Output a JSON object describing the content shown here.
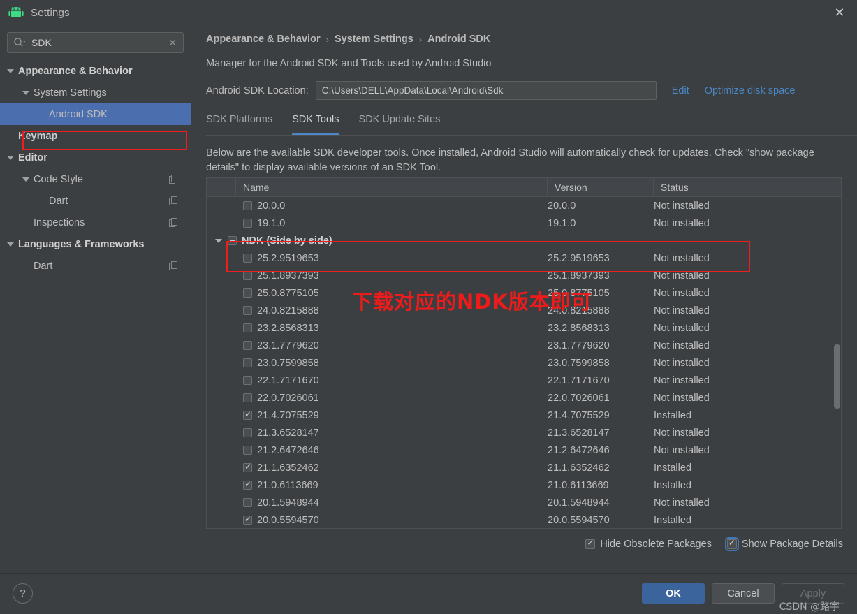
{
  "window": {
    "title": "Settings",
    "logo_icon": "android-logo-icon",
    "close_icon": "close-icon"
  },
  "search": {
    "value": "SDK",
    "placeholder": "Search settings",
    "icon": "search-icon",
    "clear_icon": "clear-icon"
  },
  "sidebar": {
    "items": [
      {
        "label": "Appearance & Behavior",
        "level": 0,
        "bold": true,
        "expandable": true,
        "selected": false,
        "copy": false
      },
      {
        "label": "System Settings",
        "level": 1,
        "bold": false,
        "expandable": true,
        "selected": false,
        "copy": false
      },
      {
        "label": "Android SDK",
        "level": 2,
        "bold": false,
        "expandable": false,
        "selected": true,
        "copy": false
      },
      {
        "label": "Keymap",
        "level": 0,
        "bold": true,
        "expandable": false,
        "selected": false,
        "copy": false
      },
      {
        "label": "Editor",
        "level": 0,
        "bold": true,
        "expandable": true,
        "selected": false,
        "copy": false
      },
      {
        "label": "Code Style",
        "level": 1,
        "bold": false,
        "expandable": true,
        "selected": false,
        "copy": true
      },
      {
        "label": "Dart",
        "level": 2,
        "bold": false,
        "expandable": false,
        "selected": false,
        "copy": true
      },
      {
        "label": "Inspections",
        "level": 1,
        "bold": false,
        "expandable": false,
        "selected": false,
        "copy": true
      },
      {
        "label": "Languages & Frameworks",
        "level": 0,
        "bold": true,
        "expandable": true,
        "selected": false,
        "copy": false
      },
      {
        "label": "Dart",
        "level": 1,
        "bold": false,
        "expandable": false,
        "selected": false,
        "copy": true
      }
    ]
  },
  "main": {
    "breadcrumb": [
      "Appearance & Behavior",
      "System Settings",
      "Android SDK"
    ],
    "breadcrumb_separator": "›",
    "subtitle": "Manager for the Android SDK and Tools used by Android Studio",
    "location_label": "Android SDK Location:",
    "location_value": "C:\\Users\\DELL\\AppData\\Local\\Android\\Sdk",
    "edit_link": "Edit",
    "optimize_link": "Optimize disk space",
    "tabs": [
      {
        "label": "SDK Platforms",
        "active": false
      },
      {
        "label": "SDK Tools",
        "active": true
      },
      {
        "label": "SDK Update Sites",
        "active": false
      }
    ],
    "description": "Below are the available SDK developer tools. Once installed, Android Studio will automatically check for updates. Check \"show package details\" to display available versions of an SDK Tool."
  },
  "table": {
    "columns": [
      "",
      "Name",
      "Version",
      "Status"
    ],
    "rows": [
      {
        "name": "20.0.0",
        "version": "20.0.0",
        "status": "Not installed",
        "state": "unchecked",
        "group": false
      },
      {
        "name": "19.1.0",
        "version": "19.1.0",
        "status": "Not installed",
        "state": "unchecked",
        "group": false
      },
      {
        "name": "NDK (Side by side)",
        "version": "",
        "status": "",
        "state": "partial",
        "group": true
      },
      {
        "name": "25.2.9519653",
        "version": "25.2.9519653",
        "status": "Not installed",
        "state": "unchecked",
        "group": false
      },
      {
        "name": "25.1.8937393",
        "version": "25.1.8937393",
        "status": "Not installed",
        "state": "unchecked",
        "group": false
      },
      {
        "name": "25.0.8775105",
        "version": "25.0.8775105",
        "status": "Not installed",
        "state": "unchecked",
        "group": false
      },
      {
        "name": "24.0.8215888",
        "version": "24.0.8215888",
        "status": "Not installed",
        "state": "unchecked",
        "group": false
      },
      {
        "name": "23.2.8568313",
        "version": "23.2.8568313",
        "status": "Not installed",
        "state": "unchecked",
        "group": false
      },
      {
        "name": "23.1.7779620",
        "version": "23.1.7779620",
        "status": "Not installed",
        "state": "unchecked",
        "group": false
      },
      {
        "name": "23.0.7599858",
        "version": "23.0.7599858",
        "status": "Not installed",
        "state": "unchecked",
        "group": false
      },
      {
        "name": "22.1.7171670",
        "version": "22.1.7171670",
        "status": "Not installed",
        "state": "unchecked",
        "group": false
      },
      {
        "name": "22.0.7026061",
        "version": "22.0.7026061",
        "status": "Not installed",
        "state": "unchecked",
        "group": false
      },
      {
        "name": "21.4.7075529",
        "version": "21.4.7075529",
        "status": "Installed",
        "state": "checked",
        "group": false
      },
      {
        "name": "21.3.6528147",
        "version": "21.3.6528147",
        "status": "Not installed",
        "state": "unchecked",
        "group": false
      },
      {
        "name": "21.2.6472646",
        "version": "21.2.6472646",
        "status": "Not installed",
        "state": "unchecked",
        "group": false
      },
      {
        "name": "21.1.6352462",
        "version": "21.1.6352462",
        "status": "Installed",
        "state": "checked",
        "group": false
      },
      {
        "name": "21.0.6113669",
        "version": "21.0.6113669",
        "status": "Installed",
        "state": "checked",
        "group": false
      },
      {
        "name": "20.1.5948944",
        "version": "20.1.5948944",
        "status": "Not installed",
        "state": "unchecked",
        "group": false
      },
      {
        "name": "20.0.5594570",
        "version": "20.0.5594570",
        "status": "Installed",
        "state": "checked",
        "group": false
      }
    ]
  },
  "options": [
    {
      "label": "Hide Obsolete Packages",
      "checked": true,
      "focused": false
    },
    {
      "label": "Show Package Details",
      "checked": true,
      "focused": true
    }
  ],
  "footer": {
    "help_icon": "help-icon",
    "help_glyph": "?",
    "buttons": [
      {
        "label": "OK",
        "kind": "primary"
      },
      {
        "label": "Cancel",
        "kind": "normal"
      },
      {
        "label": "Apply",
        "kind": "disabled"
      }
    ],
    "watermark": "CSDN @路宇"
  },
  "annotations": {
    "chinese_note": "下载对应的NDK版本即可",
    "highlight_color": "#ef1d1d"
  },
  "colors": {
    "accent": "#4a88c7",
    "selection": "#4b6eaf",
    "window_bg": "#3c3f41",
    "annotation_red": "#ee1b1b",
    "primary_button": "#3c649c"
  }
}
